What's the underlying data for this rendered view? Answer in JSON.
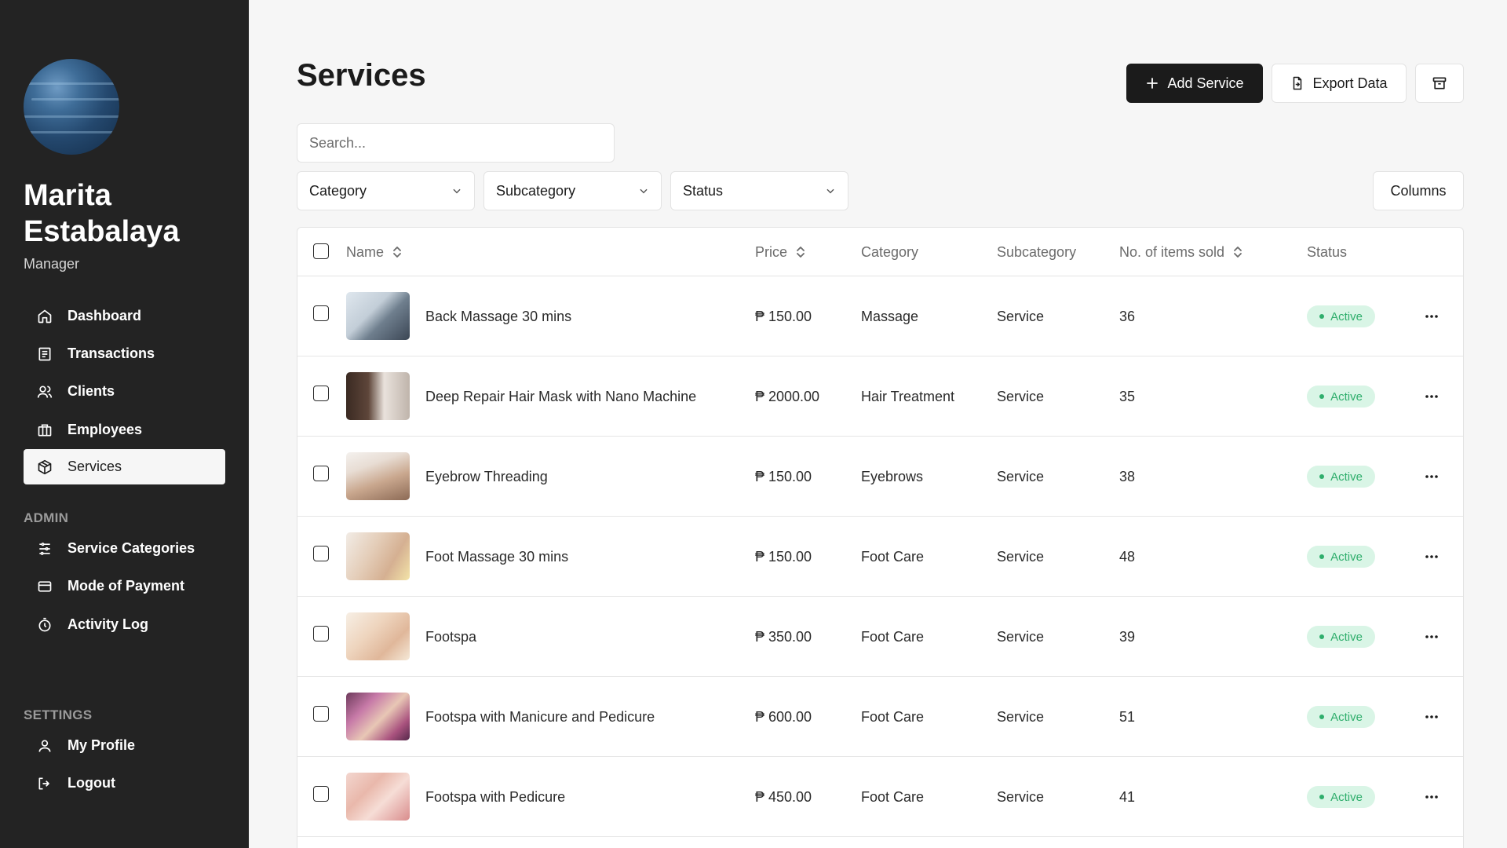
{
  "user": {
    "name": "Marita Estabalaya",
    "role": "Manager"
  },
  "sidebar": {
    "main_items": [
      {
        "label": "Dashboard",
        "icon": "home-icon"
      },
      {
        "label": "Transactions",
        "icon": "receipt-icon"
      },
      {
        "label": "Clients",
        "icon": "users-icon"
      },
      {
        "label": "Employees",
        "icon": "briefcase-icon"
      },
      {
        "label": "Services",
        "icon": "package-icon",
        "active": true
      }
    ],
    "admin_label": "ADMIN",
    "admin_items": [
      {
        "label": "Service Categories",
        "icon": "sliders-icon"
      },
      {
        "label": "Mode of Payment",
        "icon": "credit-card-icon"
      },
      {
        "label": "Activity Log",
        "icon": "timer-icon"
      }
    ],
    "settings_label": "SETTINGS",
    "settings_items": [
      {
        "label": "My Profile",
        "icon": "user-icon"
      },
      {
        "label": "Logout",
        "icon": "logout-icon"
      }
    ]
  },
  "header": {
    "title": "Services",
    "add_label": "Add Service",
    "export_label": "Export Data"
  },
  "filters": {
    "search_placeholder": "Search...",
    "category": "Category",
    "subcategory": "Subcategory",
    "status": "Status",
    "columns_label": "Columns"
  },
  "table": {
    "headers": {
      "name": "Name",
      "price": "Price",
      "category": "Category",
      "subcategory": "Subcategory",
      "items_sold": "No. of items sold",
      "status": "Status"
    },
    "rows": [
      {
        "name": "Back Massage 30 mins",
        "price": "₱ 150.00",
        "category": "Massage",
        "subcategory": "Service",
        "sold": "36",
        "status": "Active"
      },
      {
        "name": "Deep Repair Hair Mask with Nano Machine",
        "price": "₱ 2000.00",
        "category": "Hair Treatment",
        "subcategory": "Service",
        "sold": "35",
        "status": "Active"
      },
      {
        "name": "Eyebrow Threading",
        "price": "₱ 150.00",
        "category": "Eyebrows",
        "subcategory": "Service",
        "sold": "38",
        "status": "Active"
      },
      {
        "name": "Foot Massage 30 mins",
        "price": "₱ 150.00",
        "category": "Foot Care",
        "subcategory": "Service",
        "sold": "48",
        "status": "Active"
      },
      {
        "name": "Footspa",
        "price": "₱ 350.00",
        "category": "Foot Care",
        "subcategory": "Service",
        "sold": "39",
        "status": "Active"
      },
      {
        "name": "Footspa with Manicure and Pedicure",
        "price": "₱ 600.00",
        "category": "Foot Care",
        "subcategory": "Service",
        "sold": "51",
        "status": "Active"
      },
      {
        "name": "Footspa with Pedicure",
        "price": "₱ 450.00",
        "category": "Foot Care",
        "subcategory": "Service",
        "sold": "41",
        "status": "Active"
      }
    ]
  },
  "colors": {
    "sidebar_bg": "#232323",
    "page_bg": "#f6f6f6",
    "primary_button": "#1b1b1b",
    "status_active_bg": "#d9f5e6",
    "status_active_text": "#2fae6c"
  }
}
